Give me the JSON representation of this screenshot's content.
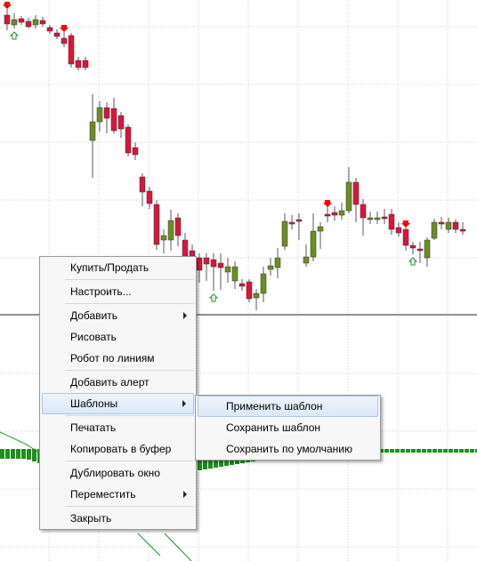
{
  "chart_data": {
    "type": "candlestick",
    "colors": {
      "bull": "#6b8e23",
      "bear": "#dc143c",
      "wick": "#5a5a5a",
      "grid": "#cfcfcf",
      "hist": "#1f8f1f",
      "osc_line": "#1f8f1f",
      "separator": "#909090",
      "arrow_down": "#ff0000",
      "arrow_up": "#2e8b2e"
    },
    "grid": true,
    "candles": [
      {
        "o": 17,
        "c": 27,
        "h": 10,
        "l": 34
      },
      {
        "o": 28,
        "c": 22,
        "h": 15,
        "l": 32
      },
      {
        "o": 21,
        "c": 25,
        "h": 18,
        "l": 28
      },
      {
        "o": 24,
        "c": 30,
        "h": 20,
        "l": 32
      },
      {
        "o": 28,
        "c": 22,
        "h": 17,
        "l": 32
      },
      {
        "o": 23,
        "c": 27,
        "h": 19,
        "l": 30
      },
      {
        "o": 31,
        "c": 35,
        "h": 28,
        "l": 38
      },
      {
        "o": 37,
        "c": 41,
        "h": 33,
        "l": 44
      },
      {
        "o": 43,
        "c": 49,
        "h": 36,
        "l": 53
      },
      {
        "o": 40,
        "c": 72,
        "h": 37,
        "l": 76
      },
      {
        "o": 68,
        "c": 76,
        "h": 64,
        "l": 79
      },
      {
        "o": 68,
        "c": 76,
        "h": 64,
        "l": 79
      },
      {
        "o": 158,
        "c": 137,
        "h": 106,
        "l": 200
      },
      {
        "o": 137,
        "c": 121,
        "h": 114,
        "l": 148
      },
      {
        "o": 121,
        "c": 133,
        "h": 115,
        "l": 150
      },
      {
        "o": 122,
        "c": 147,
        "h": 110,
        "l": 150
      },
      {
        "o": 130,
        "c": 145,
        "h": 126,
        "l": 155
      },
      {
        "o": 143,
        "c": 172,
        "h": 140,
        "l": 176
      },
      {
        "o": 166,
        "c": 174,
        "h": 160,
        "l": 180
      },
      {
        "o": 199,
        "c": 216,
        "h": 195,
        "l": 232
      },
      {
        "o": 215,
        "c": 229,
        "h": 210,
        "l": 235
      },
      {
        "o": 230,
        "c": 275,
        "h": 225,
        "l": 281
      },
      {
        "o": 270,
        "c": 265,
        "h": 258,
        "l": 285
      },
      {
        "o": 270,
        "c": 248,
        "h": 236,
        "l": 282
      },
      {
        "o": 245,
        "c": 265,
        "h": 240,
        "l": 277
      },
      {
        "o": 270,
        "c": 294,
        "h": 262,
        "l": 300
      },
      {
        "o": 282,
        "c": 305,
        "h": 275,
        "l": 315
      },
      {
        "o": 290,
        "c": 304,
        "h": 285,
        "l": 318
      },
      {
        "o": 290,
        "c": 297,
        "h": 285,
        "l": 316
      },
      {
        "o": 292,
        "c": 300,
        "h": 285,
        "l": 327
      },
      {
        "o": 296,
        "c": 301,
        "h": 285,
        "l": 326
      },
      {
        "o": 306,
        "c": 300,
        "h": 290,
        "l": 318
      },
      {
        "o": 316,
        "c": 300,
        "h": 294,
        "l": 325
      },
      {
        "o": 319,
        "c": 322,
        "h": 314,
        "l": 327
      },
      {
        "o": 317,
        "c": 336,
        "h": 314,
        "l": 340
      },
      {
        "o": 335,
        "c": 330,
        "h": 325,
        "l": 349
      },
      {
        "o": 330,
        "c": 308,
        "h": 300,
        "l": 340
      },
      {
        "o": 303,
        "c": 299,
        "h": 290,
        "l": 310
      },
      {
        "o": 301,
        "c": 290,
        "h": 279,
        "l": 313
      },
      {
        "o": 277,
        "c": 249,
        "h": 240,
        "l": 281
      },
      {
        "o": 250,
        "c": 250,
        "h": 242,
        "l": 258
      },
      {
        "o": 247,
        "c": 248,
        "h": 240,
        "l": 270
      },
      {
        "o": 296,
        "c": 289,
        "h": 275,
        "l": 300
      },
      {
        "o": 289,
        "c": 260,
        "h": 240,
        "l": 294
      },
      {
        "o": 260,
        "c": 255,
        "h": 250,
        "l": 280
      },
      {
        "o": 241,
        "c": 242,
        "h": 233,
        "l": 250
      },
      {
        "o": 239,
        "c": 242,
        "h": 232,
        "l": 248
      },
      {
        "o": 242,
        "c": 237,
        "h": 228,
        "l": 247
      },
      {
        "o": 237,
        "c": 205,
        "h": 188,
        "l": 240
      },
      {
        "o": 205,
        "c": 230,
        "h": 200,
        "l": 250
      },
      {
        "o": 230,
        "c": 245,
        "h": 224,
        "l": 265
      },
      {
        "o": 246,
        "c": 245,
        "h": 238,
        "l": 252
      },
      {
        "o": 246,
        "c": 245,
        "h": 238,
        "l": 252
      },
      {
        "o": 244,
        "c": 245,
        "h": 235,
        "l": 252
      },
      {
        "o": 241,
        "c": 258,
        "h": 235,
        "l": 264
      },
      {
        "o": 256,
        "c": 262,
        "h": 250,
        "l": 266
      },
      {
        "o": 258,
        "c": 276,
        "h": 256,
        "l": 282
      },
      {
        "o": 276,
        "c": 279,
        "h": 272,
        "l": 286
      },
      {
        "o": 280,
        "c": 282,
        "h": 272,
        "l": 296
      },
      {
        "o": 290,
        "c": 270,
        "h": 267,
        "l": 300
      },
      {
        "o": 268,
        "c": 250,
        "h": 246,
        "l": 270
      },
      {
        "o": 250,
        "c": 250,
        "h": 244,
        "l": 258
      },
      {
        "o": 258,
        "c": 250,
        "h": 245,
        "l": 262
      },
      {
        "o": 250,
        "c": 258,
        "h": 247,
        "l": 262
      },
      {
        "o": 258,
        "c": 258,
        "h": 250,
        "l": 264
      }
    ],
    "signals_down": [
      0,
      8,
      45,
      56
    ],
    "signals_up": [
      1,
      29,
      57
    ],
    "histogram_baseline": 505,
    "histogram": [
      11,
      11,
      11,
      11,
      11,
      12,
      14,
      16,
      18,
      20,
      22,
      24,
      26,
      28,
      30,
      31,
      32,
      33,
      34,
      35,
      35,
      36,
      36,
      36,
      36,
      35,
      34,
      34,
      33,
      32,
      31,
      30,
      29,
      28,
      27,
      26,
      25,
      24,
      23,
      22,
      21,
      20,
      19,
      18,
      17,
      16,
      15,
      14,
      13,
      12,
      11,
      10,
      10,
      9,
      9,
      8,
      8,
      8,
      7,
      7,
      7,
      7,
      6,
      6,
      6,
      5,
      5,
      5,
      5,
      5,
      4,
      4,
      4,
      4,
      4,
      4,
      4,
      4,
      4,
      4,
      4,
      4,
      4,
      4,
      4,
      4,
      4,
      4,
      4,
      4,
      4,
      4
    ]
  },
  "context_menu": {
    "items": [
      {
        "label": "Купить/Продать",
        "name": "menu-item-buy-sell",
        "submenu": false,
        "sep_after": true
      },
      {
        "label": "Настроить...",
        "name": "menu-item-configure",
        "submenu": false,
        "sep_after": true
      },
      {
        "label": "Добавить",
        "name": "menu-item-add",
        "submenu": true,
        "sep_after": false
      },
      {
        "label": "Рисовать",
        "name": "menu-item-draw",
        "submenu": false,
        "sep_after": false
      },
      {
        "label": "Робот по линиям",
        "name": "menu-item-line-robot",
        "submenu": false,
        "sep_after": true
      },
      {
        "label": "Добавить алерт",
        "name": "menu-item-add-alert",
        "submenu": false,
        "sep_after": false
      },
      {
        "label": "Шаблоны",
        "name": "menu-item-templates",
        "submenu": true,
        "sep_after": true,
        "highlighted": true
      },
      {
        "label": "Печатать",
        "name": "menu-item-print",
        "submenu": false,
        "sep_after": false
      },
      {
        "label": "Копировать в буфер",
        "name": "menu-item-copy-to-clipboard",
        "submenu": false,
        "sep_after": true
      },
      {
        "label": "Дублировать окно",
        "name": "menu-item-duplicate-window",
        "submenu": false,
        "sep_after": false
      },
      {
        "label": "Переместить",
        "name": "menu-item-move",
        "submenu": true,
        "sep_after": true
      },
      {
        "label": "Закрыть",
        "name": "menu-item-close",
        "submenu": false,
        "sep_after": false
      }
    ]
  },
  "templates_submenu": {
    "items": [
      {
        "label": "Применить шаблон",
        "name": "submenu-item-apply-template",
        "highlighted": true
      },
      {
        "label": "Сохранить шаблон",
        "name": "submenu-item-save-template"
      },
      {
        "label": "Сохранить по умолчанию",
        "name": "submenu-item-save-default"
      }
    ]
  }
}
